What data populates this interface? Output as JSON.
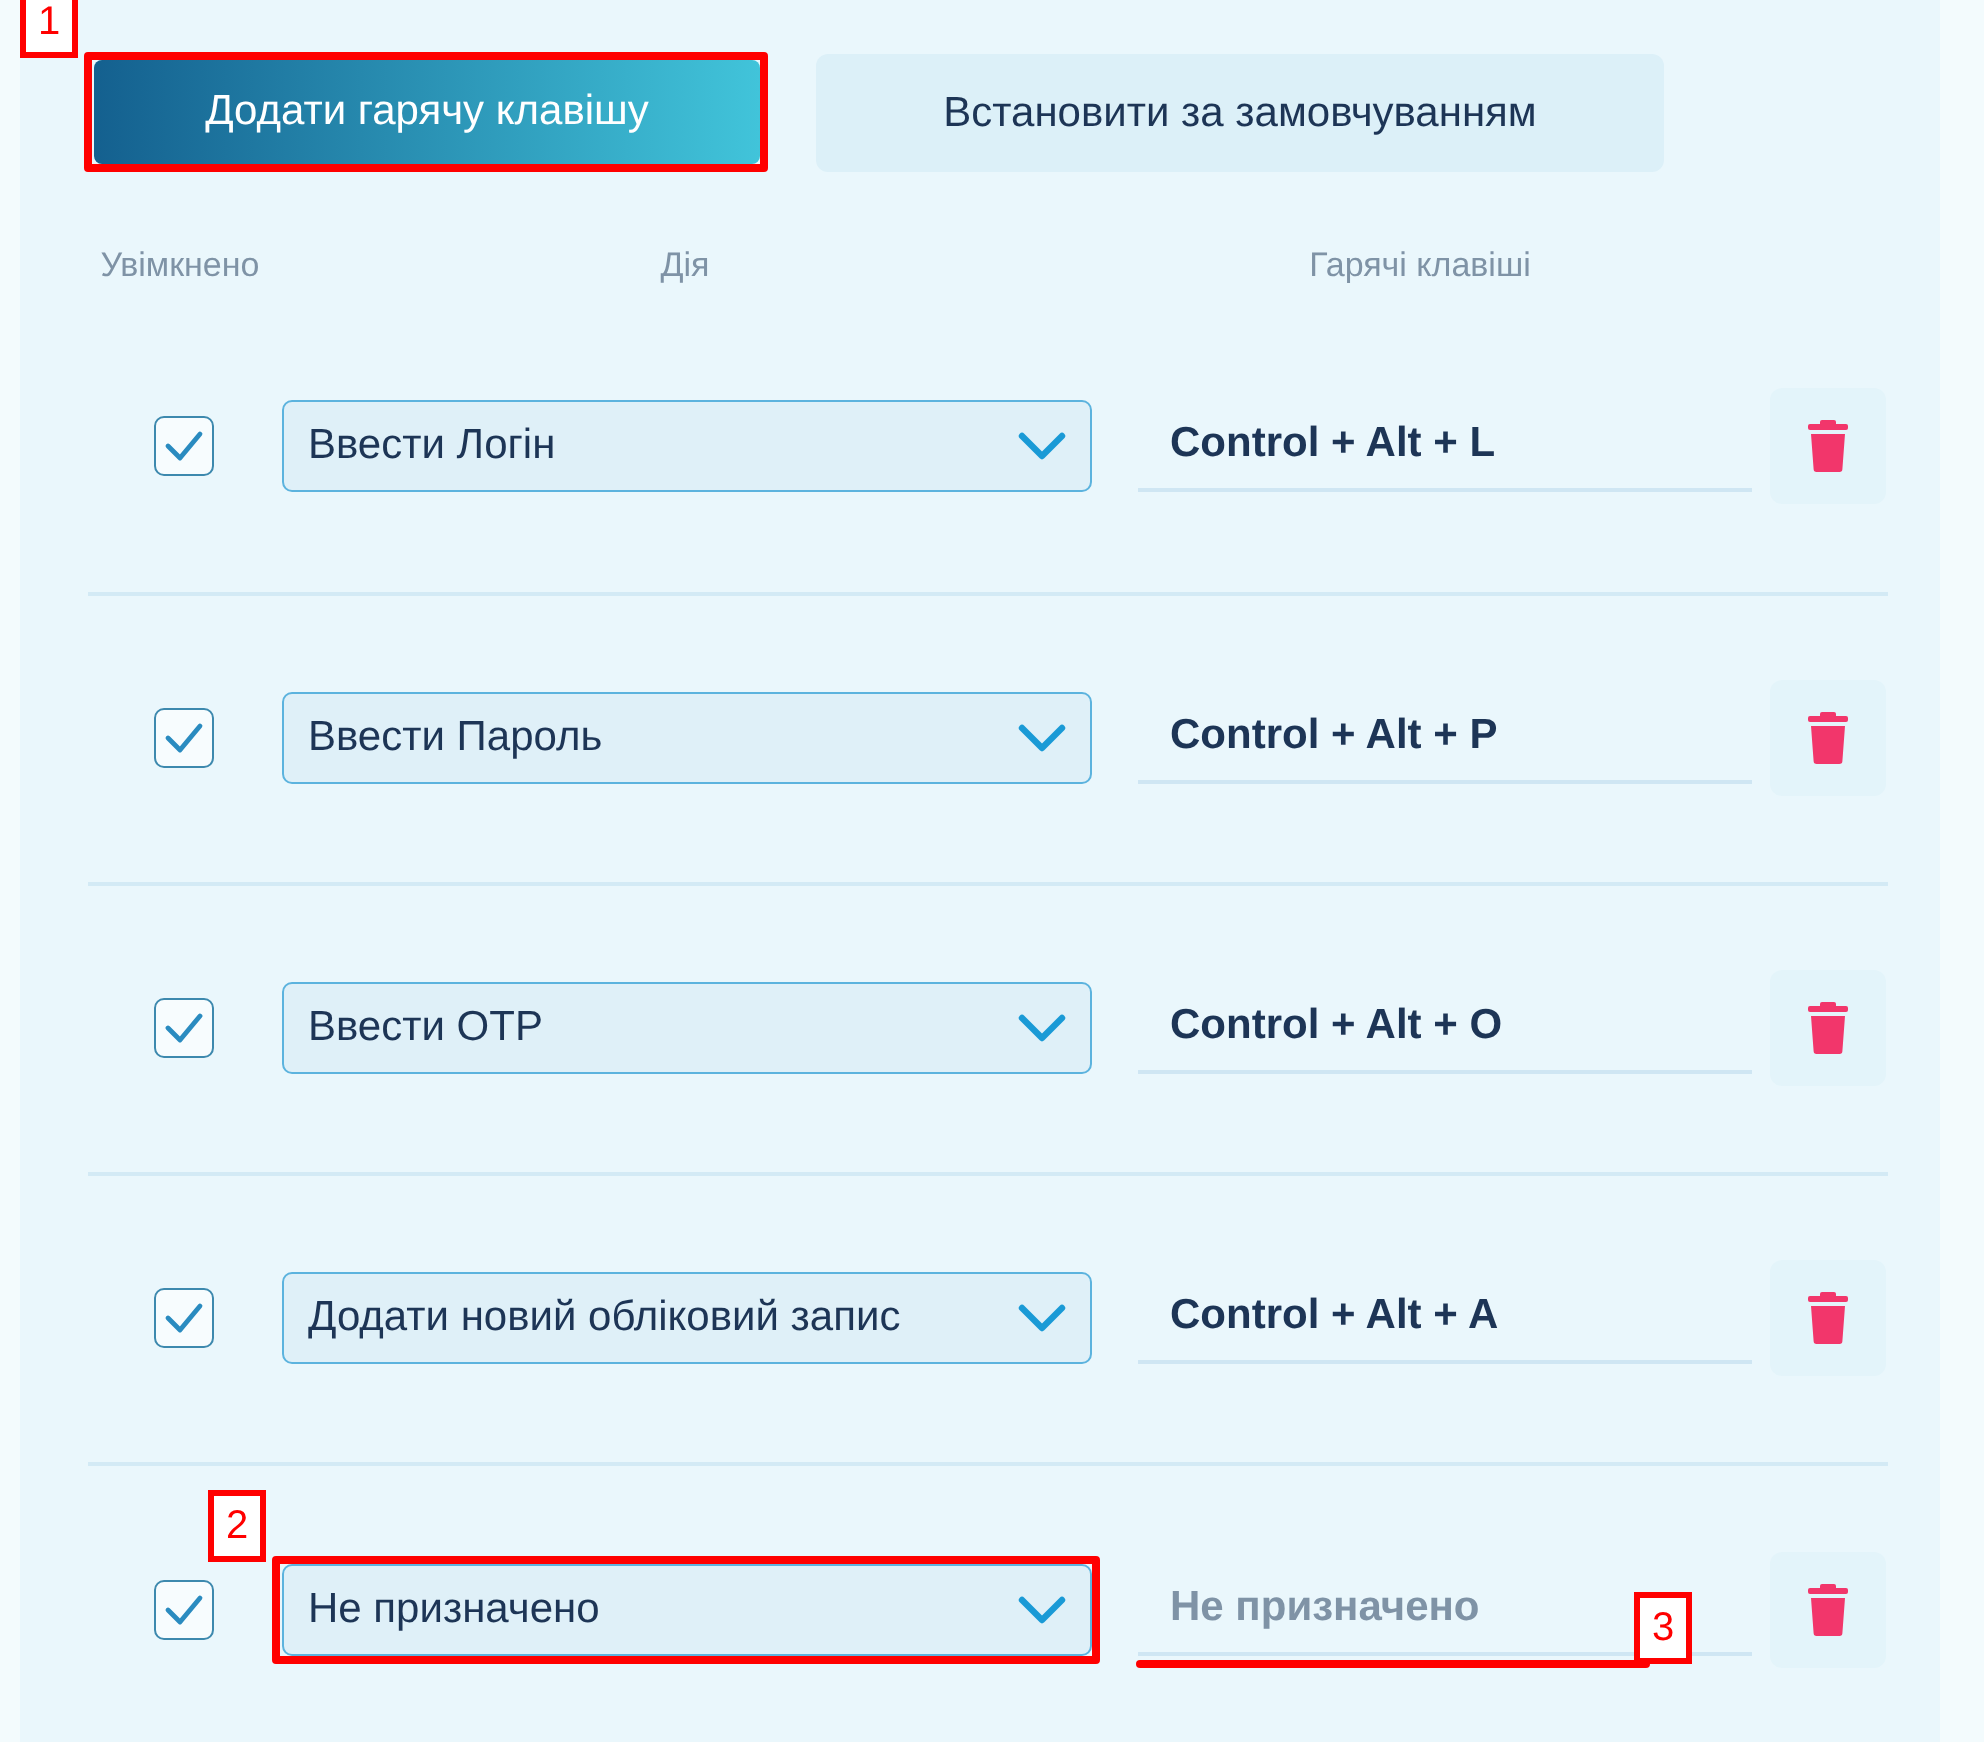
{
  "buttons": [
    {
      "label": "Додати гарячу клавішу",
      "kind": "primary",
      "annotation": {
        "label": "1",
        "kind": "frame"
      }
    },
    {
      "label": "Встановити за замовчуванням",
      "kind": "secondary"
    }
  ],
  "columns": [
    "Увімкнено",
    "Дія",
    "Гарячі клавіші"
  ],
  "rows": [
    {
      "enabled": true,
      "action": "Ввести Логін",
      "hotkey": "Control + Alt + L"
    },
    {
      "enabled": true,
      "action": "Ввести Пароль",
      "hotkey": "Control + Alt + P"
    },
    {
      "enabled": true,
      "action": "Ввести OTP",
      "hotkey": "Control + Alt + O"
    },
    {
      "enabled": true,
      "action": "Додати новий обліковий запис",
      "hotkey": "Control + Alt + A"
    },
    {
      "enabled": true,
      "action": "Не призначено",
      "placeholder": "Не призначено",
      "action_annotation": {
        "label": "2",
        "kind": "frame"
      },
      "hotkey_annotation": {
        "label": "3",
        "kind": "underline"
      }
    }
  ]
}
